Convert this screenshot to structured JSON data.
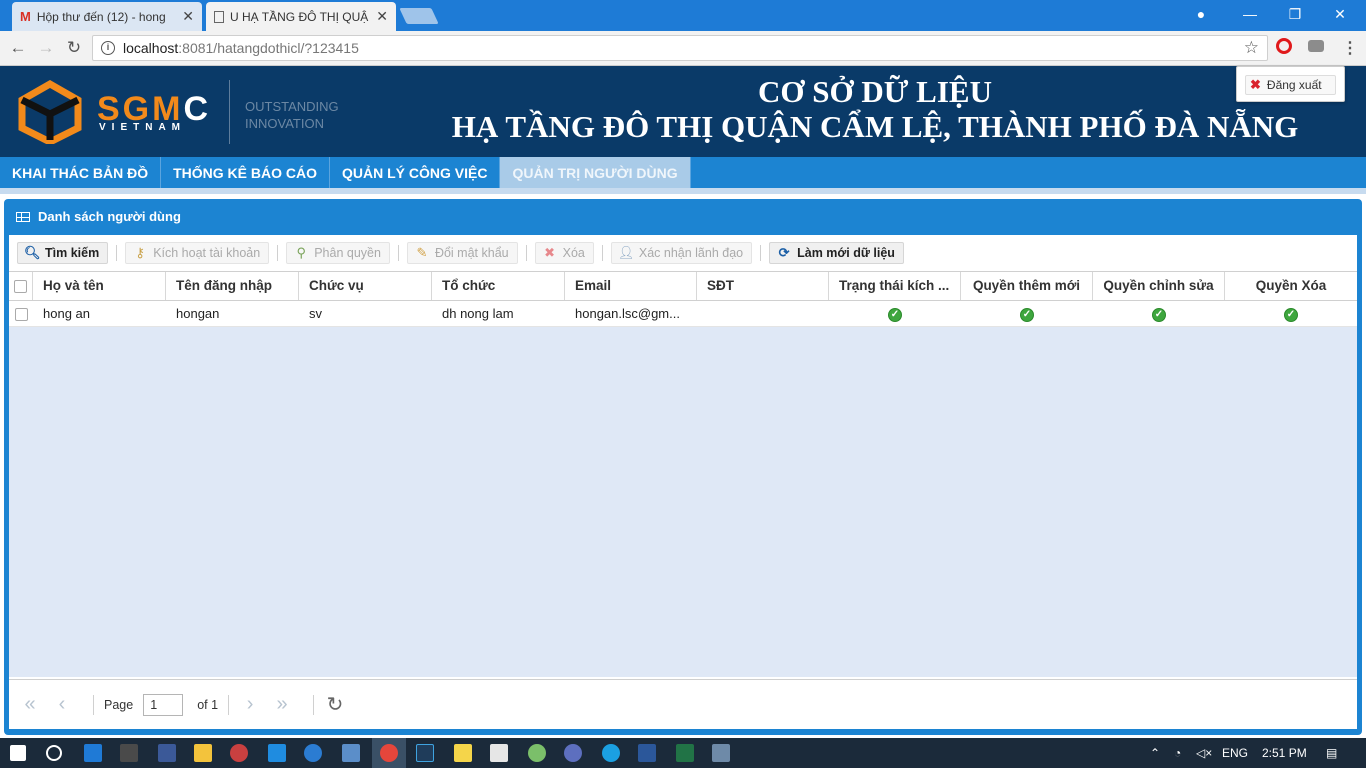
{
  "browser": {
    "tabs": [
      {
        "title": "Hộp thư đến (12) - hong"
      },
      {
        "title": "U HẠ TẦNG ĐÔ THỊ QUẬ"
      }
    ],
    "url_host": "localhost",
    "url_path": ":8081/hatangdothicl/?123415"
  },
  "banner": {
    "logo_sgm": "SGM",
    "logo_c": "C",
    "logo_vietnam": "VIETNAM",
    "tag_line1": "OUTSTANDING",
    "tag_line2": "INNOVATION",
    "title_line1": "CƠ SỞ DỮ LIỆU",
    "title_line2": "HẠ TẦNG ĐÔ THỊ QUẬN CẨM LỆ, THÀNH PHỐ ĐÀ NẴNG",
    "logout": "Đăng xuất"
  },
  "menu": {
    "items": [
      "KHAI THÁC BẢN ĐỒ",
      "THỐNG KÊ BÁO CÁO",
      "QUẢN LÝ CÔNG VIỆC",
      "QUẢN TRỊ NGƯỜI DÙNG"
    ]
  },
  "panel": {
    "title": "Danh sách người dùng",
    "toolbar": {
      "search": "Tìm kiếm",
      "activate": "Kích hoạt tài khoản",
      "assign": "Phân quyền",
      "change_password": "Đổi mật khẩu",
      "delete": "Xóa",
      "confirm_leader": "Xác nhận lãnh đạo",
      "refresh": "Làm mới dữ liệu"
    },
    "columns": [
      "Họ và tên",
      "Tên đăng nhập",
      "Chức vụ",
      "Tổ chức",
      "Email",
      "SĐT",
      "Trạng thái kích ...",
      "Quyền thêm mới",
      "Quyền chỉnh sửa",
      "Quyền Xóa"
    ],
    "rows": [
      {
        "name": "hong an",
        "username": "hongan",
        "position": "sv",
        "organization": "dh nong lam",
        "email": "hongan.lsc@gm...",
        "phone": ""
      }
    ],
    "pager": {
      "page_label": "Page",
      "page_value": "1",
      "of_label": "of 1"
    }
  },
  "taskbar": {
    "language": "ENG",
    "time": "2:51 PM"
  }
}
